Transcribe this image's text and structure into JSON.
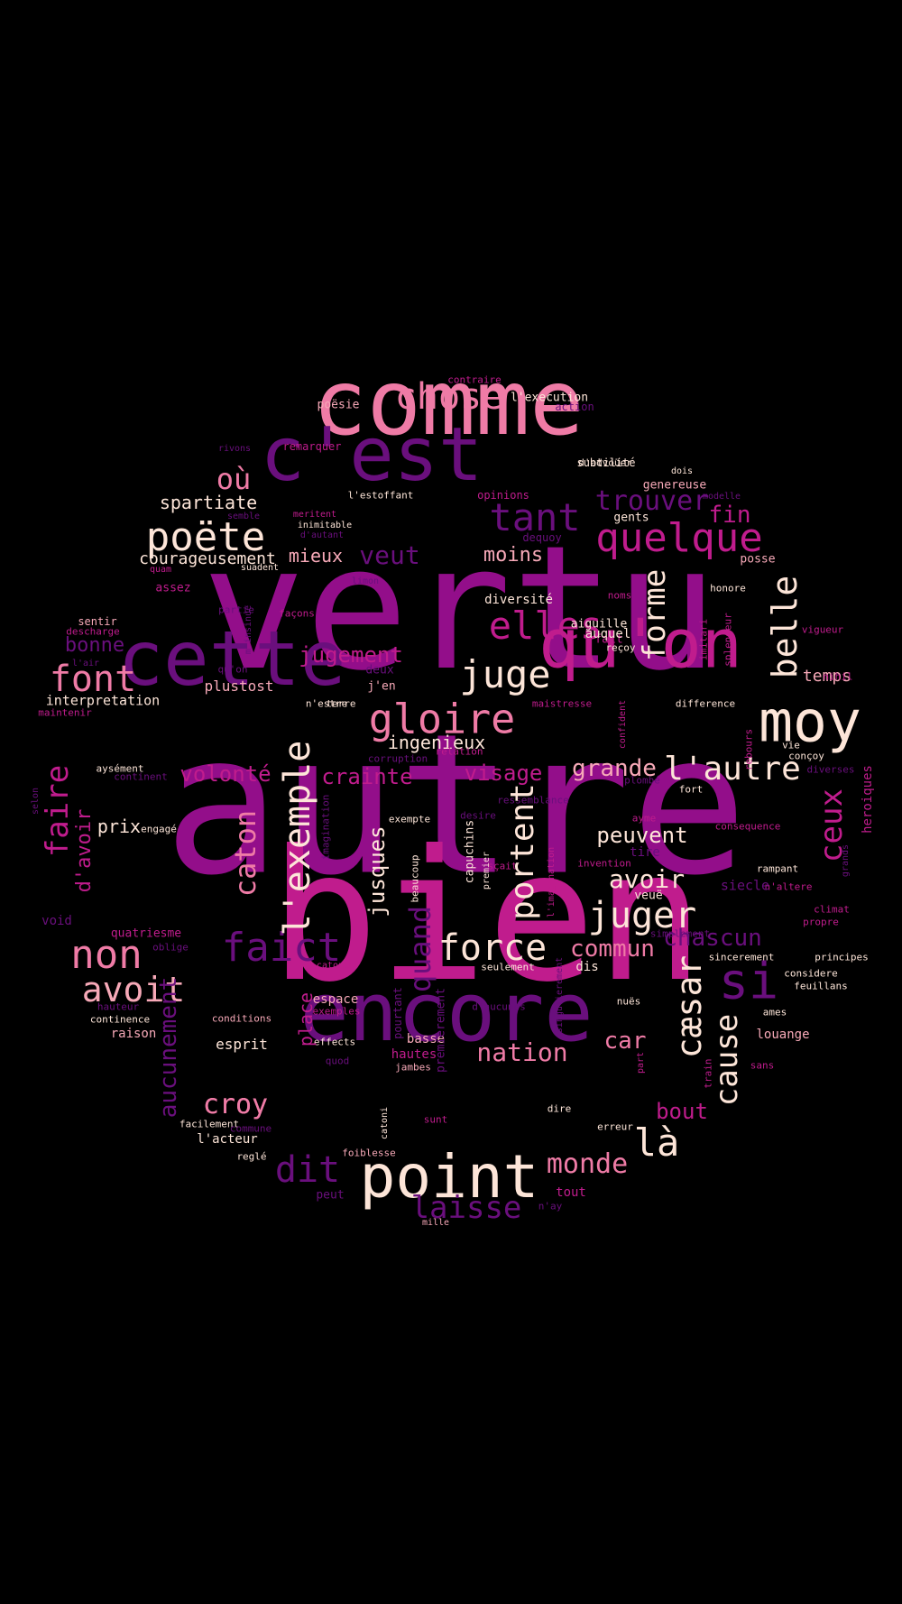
{
  "palette": {
    "magenta": "#930e8a",
    "purple": "#6a0f7d",
    "pink": "#ef7ba6",
    "hot": "#c01c8d",
    "cream": "#fde5d8",
    "rose": "#f7a9b8",
    "white": "#ffffff"
  },
  "words": [
    {
      "text": "vertu",
      "color": "magenta"
    },
    {
      "text": "autre",
      "color": "magenta"
    },
    {
      "text": "bien",
      "color": "hot"
    },
    {
      "text": "comme",
      "color": "pink"
    },
    {
      "text": "c'est",
      "color": "purple"
    },
    {
      "text": "cette",
      "color": "purple"
    },
    {
      "text": "qu'on",
      "color": "hot"
    },
    {
      "text": "encore",
      "color": "purple"
    },
    {
      "text": "point",
      "color": "cream"
    },
    {
      "text": "moy",
      "color": "cream"
    },
    {
      "text": "gloire",
      "color": "pink"
    },
    {
      "text": "chose",
      "color": "pink"
    },
    {
      "text": "tant",
      "color": "purple"
    },
    {
      "text": "quelque",
      "color": "hot"
    },
    {
      "text": "poëte",
      "color": "cream"
    },
    {
      "text": "trouver",
      "color": "purple"
    },
    {
      "text": "elles",
      "color": "hot"
    },
    {
      "text": "juge",
      "color": "cream"
    },
    {
      "text": "font",
      "color": "pink"
    },
    {
      "text": "non",
      "color": "pink"
    },
    {
      "text": "avoit",
      "color": "rose"
    },
    {
      "text": "faict",
      "color": "purple"
    },
    {
      "text": "force",
      "color": "cream"
    },
    {
      "text": "juger",
      "color": "cream"
    },
    {
      "text": "l'autre",
      "color": "cream"
    },
    {
      "text": "si",
      "color": "purple"
    },
    {
      "text": "là",
      "color": "cream"
    },
    {
      "text": "dit",
      "color": "purple"
    },
    {
      "text": "laisse",
      "color": "purple"
    },
    {
      "text": "monde",
      "color": "pink"
    },
    {
      "text": "croy",
      "color": "pink"
    },
    {
      "text": "nation",
      "color": "pink"
    },
    {
      "text": "commun",
      "color": "pink"
    },
    {
      "text": "chascun",
      "color": "purple"
    },
    {
      "text": "avoir",
      "color": "cream"
    },
    {
      "text": "peuvent",
      "color": "cream"
    },
    {
      "text": "grande",
      "color": "rose"
    },
    {
      "text": "visage",
      "color": "hot"
    },
    {
      "text": "crainte",
      "color": "hot"
    },
    {
      "text": "volonté",
      "color": "hot"
    },
    {
      "text": "jugement",
      "color": "hot"
    },
    {
      "text": "veut",
      "color": "purple"
    },
    {
      "text": "mieux",
      "color": "rose"
    },
    {
      "text": "moins",
      "color": "rose"
    },
    {
      "text": "où",
      "color": "pink"
    },
    {
      "text": "fin",
      "color": "hot"
    },
    {
      "text": "temps",
      "color": "rose"
    },
    {
      "text": "bonne",
      "color": "purple"
    },
    {
      "text": "spartiate",
      "color": "cream"
    },
    {
      "text": "courageusement",
      "color": "cream"
    },
    {
      "text": "ingenieux",
      "color": "cream"
    },
    {
      "text": "interpretation",
      "color": "cream"
    },
    {
      "text": "plustost",
      "color": "rose"
    },
    {
      "text": "prix",
      "color": "cream"
    },
    {
      "text": "car",
      "color": "pink"
    },
    {
      "text": "bout",
      "color": "hot"
    },
    {
      "text": "croy",
      "color": "pink"
    },
    {
      "text": "esprit",
      "color": "cream"
    },
    {
      "text": "raison",
      "color": "rose"
    },
    {
      "text": "espace",
      "color": "rose"
    },
    {
      "text": "basse",
      "color": "rose"
    },
    {
      "text": "hautes",
      "color": "hot"
    },
    {
      "text": "louange",
      "color": "rose"
    },
    {
      "text": "l'acteur",
      "color": "cream"
    },
    {
      "text": "tout",
      "color": "hot"
    },
    {
      "text": "peut",
      "color": "purple"
    },
    {
      "text": "mille",
      "color": "rose"
    },
    {
      "text": "n'ay",
      "color": "purple"
    },
    {
      "text": "sunt",
      "color": "hot"
    },
    {
      "text": "erreur",
      "color": "cream"
    },
    {
      "text": "dire",
      "color": "cream"
    },
    {
      "text": "sans",
      "color": "hot"
    },
    {
      "text": "quatriesme",
      "color": "hot"
    },
    {
      "text": "void",
      "color": "purple"
    },
    {
      "text": "assez",
      "color": "hot"
    },
    {
      "text": "sentir",
      "color": "rose"
    },
    {
      "text": "descharge",
      "color": "hot"
    },
    {
      "text": "l'air",
      "color": "purple"
    },
    {
      "text": "maintenir",
      "color": "hot"
    },
    {
      "text": "aysément",
      "color": "cream"
    },
    {
      "text": "continent",
      "color": "purple"
    },
    {
      "text": "engagé",
      "color": "cream"
    },
    {
      "text": "oblige",
      "color": "purple"
    },
    {
      "text": "hauteur",
      "color": "purple"
    },
    {
      "text": "continence",
      "color": "cream"
    },
    {
      "text": "conditions",
      "color": "rose"
    },
    {
      "text": "exemples",
      "color": "hot"
    },
    {
      "text": "effects",
      "color": "cream"
    },
    {
      "text": "quod",
      "color": "purple"
    },
    {
      "text": "jambes",
      "color": "rose"
    },
    {
      "text": "facilement",
      "color": "cream"
    },
    {
      "text": "commune",
      "color": "purple"
    },
    {
      "text": "reglé",
      "color": "cream"
    },
    {
      "text": "foiblesse",
      "color": "rose"
    },
    {
      "text": "d'aucunes",
      "color": "purple"
    },
    {
      "text": "nuës",
      "color": "cream"
    },
    {
      "text": "dis",
      "color": "cream"
    },
    {
      "text": "seulement",
      "color": "cream"
    },
    {
      "text": "sincerement",
      "color": "cream"
    },
    {
      "text": "principes",
      "color": "cream"
    },
    {
      "text": "considere",
      "color": "cream"
    },
    {
      "text": "feuillans",
      "color": "cream"
    },
    {
      "text": "ames",
      "color": "cream"
    },
    {
      "text": "simplement",
      "color": "purple"
    },
    {
      "text": "propre",
      "color": "hot"
    },
    {
      "text": "climat",
      "color": "hot"
    },
    {
      "text": "n'altere",
      "color": "hot"
    },
    {
      "text": "siecle",
      "color": "purple"
    },
    {
      "text": "veuë",
      "color": "cream"
    },
    {
      "text": "invention",
      "color": "hot"
    },
    {
      "text": "tire",
      "color": "purple"
    },
    {
      "text": "sçait",
      "color": "hot"
    },
    {
      "text": "ayme",
      "color": "hot"
    },
    {
      "text": "consequence",
      "color": "hot"
    },
    {
      "text": "rampant",
      "color": "cream"
    },
    {
      "text": "ressemblance",
      "color": "purple"
    },
    {
      "text": "desire",
      "color": "purple"
    },
    {
      "text": "exempte",
      "color": "cream"
    },
    {
      "text": "plombé",
      "color": "purple"
    },
    {
      "text": "fort",
      "color": "cream"
    },
    {
      "text": "diverses",
      "color": "purple"
    },
    {
      "text": "conçoy",
      "color": "cream"
    },
    {
      "text": "vie",
      "color": "cream"
    },
    {
      "text": "difference",
      "color": "cream"
    },
    {
      "text": "maistresse",
      "color": "hot"
    },
    {
      "text": "relation",
      "color": "hot"
    },
    {
      "text": "corruption",
      "color": "purple"
    },
    {
      "text": "j'en",
      "color": "rose"
    },
    {
      "text": "deux",
      "color": "purple"
    },
    {
      "text": "terre",
      "color": "cream"
    },
    {
      "text": "n'estre",
      "color": "cream"
    },
    {
      "text": "qu'on",
      "color": "purple"
    },
    {
      "text": "façons",
      "color": "hot"
    },
    {
      "text": "partie",
      "color": "purple"
    },
    {
      "text": "fait",
      "color": "hot"
    },
    {
      "text": "diversité",
      "color": "cream"
    },
    {
      "text": "aiguille",
      "color": "cream"
    },
    {
      "text": "reçoy",
      "color": "cream"
    },
    {
      "text": "auquel",
      "color": "cream"
    },
    {
      "text": "noms",
      "color": "hot"
    },
    {
      "text": "limon",
      "color": "purple"
    },
    {
      "text": "honore",
      "color": "cream"
    },
    {
      "text": "vigueur",
      "color": "hot"
    },
    {
      "text": "nihil",
      "color": "hot"
    },
    {
      "text": "posse",
      "color": "rose"
    },
    {
      "text": "genereuse",
      "color": "rose"
    },
    {
      "text": "subtilité",
      "color": "cream"
    },
    {
      "text": "gents",
      "color": "cream"
    },
    {
      "text": "dequoy",
      "color": "purple"
    },
    {
      "text": "opinions",
      "color": "hot"
    },
    {
      "text": "l'estoffant",
      "color": "cream"
    },
    {
      "text": "d'advoüer",
      "color": "cream"
    },
    {
      "text": "dois",
      "color": "cream"
    },
    {
      "text": "modelle",
      "color": "purple"
    },
    {
      "text": "meritent",
      "color": "hot"
    },
    {
      "text": "inimitable",
      "color": "cream"
    },
    {
      "text": "d'autant",
      "color": "purple"
    },
    {
      "text": "semble",
      "color": "purple"
    },
    {
      "text": "quam",
      "color": "hot"
    },
    {
      "text": "suadent",
      "color": "cream"
    },
    {
      "text": "rivons",
      "color": "purple"
    },
    {
      "text": "remarquer",
      "color": "hot"
    },
    {
      "text": "poësie",
      "color": "rose"
    },
    {
      "text": "contraire",
      "color": "hot"
    },
    {
      "text": "l'execution",
      "color": "cream"
    },
    {
      "text": "action",
      "color": "purple"
    },
    {
      "text": "catonem",
      "color": "hot"
    },
    {
      "text": "selon",
      "color": "purple"
    },
    {
      "text": "heroiques",
      "color": "hot"
    },
    {
      "text": "l'exemple",
      "color": "cream"
    },
    {
      "text": "caton",
      "color": "pink"
    },
    {
      "text": "jusques",
      "color": "cream"
    },
    {
      "text": "portent",
      "color": "cream"
    },
    {
      "text": "quand",
      "color": "purple"
    },
    {
      "text": "forme",
      "color": "cream"
    },
    {
      "text": "belle",
      "color": "cream"
    },
    {
      "text": "cæsar",
      "color": "cream"
    },
    {
      "text": "cause",
      "color": "cream"
    },
    {
      "text": "ceux",
      "color": "hot"
    },
    {
      "text": "faire",
      "color": "hot"
    },
    {
      "text": "d'avoir",
      "color": "hot"
    },
    {
      "text": "aucunement",
      "color": "purple"
    },
    {
      "text": "place",
      "color": "hot"
    },
    {
      "text": "pourtant",
      "color": "purple"
    },
    {
      "text": "premierement",
      "color": "purple"
    },
    {
      "text": "catoni",
      "color": "cream"
    },
    {
      "text": "beaucoup",
      "color": "cream"
    },
    {
      "text": "capuchins",
      "color": "cream"
    },
    {
      "text": "premier",
      "color": "cream"
    },
    {
      "text": "imagination",
      "color": "purple"
    },
    {
      "text": "l'imagination",
      "color": "hot"
    },
    {
      "text": "singulierement",
      "color": "purple"
    },
    {
      "text": "part",
      "color": "hot"
    },
    {
      "text": "train",
      "color": "hot"
    },
    {
      "text": "confident",
      "color": "hot"
    },
    {
      "text": "imitari",
      "color": "hot"
    },
    {
      "text": "splendeur",
      "color": "hot"
    },
    {
      "text": "grands",
      "color": "purple"
    },
    {
      "text": "m'insinue",
      "color": "purple"
    },
    {
      "text": "rebours",
      "color": "hot"
    },
    {
      "text": "faillent",
      "color": "purple"
    }
  ]
}
